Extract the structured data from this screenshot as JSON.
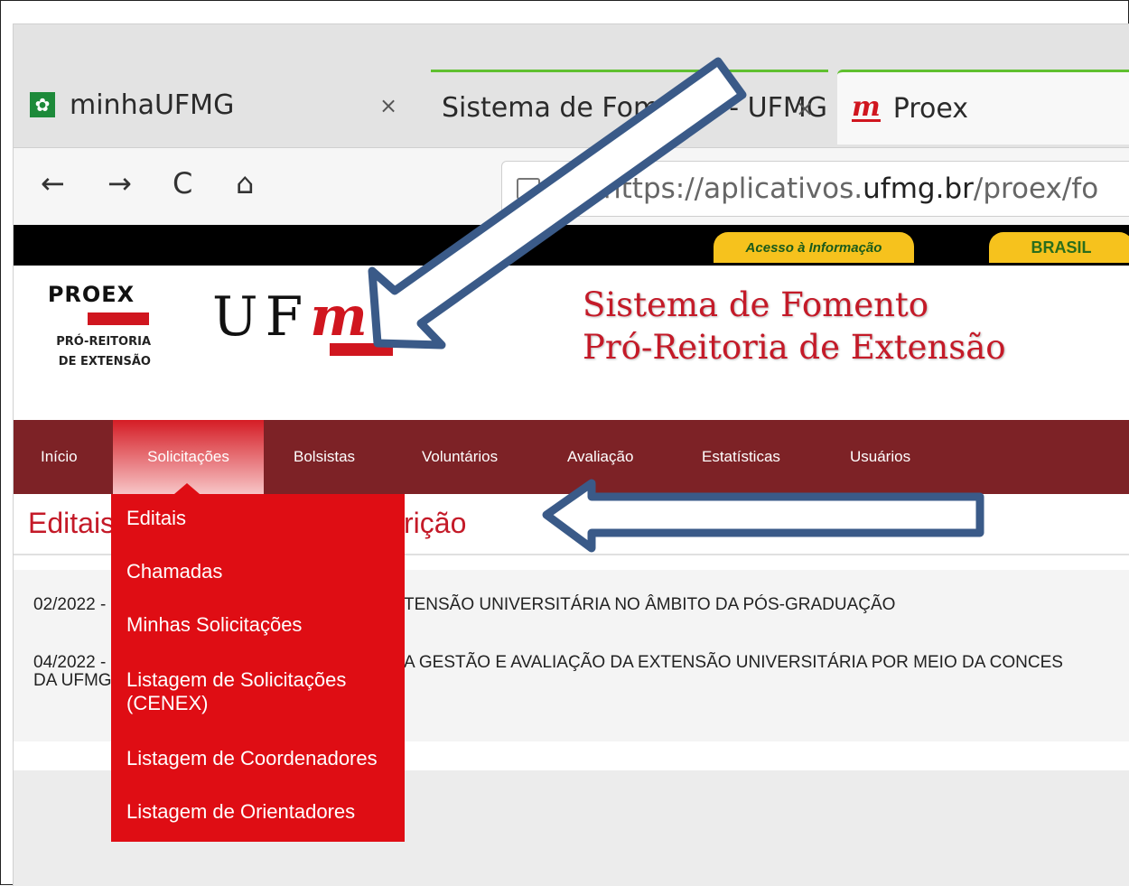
{
  "browser": {
    "tabs": [
      {
        "title": "minhaUFMG",
        "favicon": "ufmg-leaf-icon",
        "close": "×"
      },
      {
        "title": "Sistema de Fomento - UFMG",
        "close": "×"
      },
      {
        "title": "Proex",
        "favicon": "m-logo-icon"
      }
    ],
    "nav": {
      "back": "←",
      "forward": "→",
      "reload": "C",
      "home": "⌂"
    },
    "url": {
      "scheme": "https://aplicativos.",
      "domain": "ufmg.br",
      "path": "/proex/fo"
    }
  },
  "govbar": {
    "access": "Acesso à Informação",
    "brasil": "BRASIL"
  },
  "header": {
    "proex": "PROEX",
    "proex_sub1": "PRÓ-REITORIA",
    "proex_sub2": "DE EXTENSÃO",
    "ufmg_left": "UF",
    "ufmg_m": "m",
    "ufmg_right": "G",
    "system_line1": "Sistema de Fomento",
    "system_line2": "Pró-Reitoria de Extensão"
  },
  "nav": {
    "items": [
      "Início",
      "Solicitações",
      "Bolsistas",
      "Voluntários",
      "Avaliação",
      "Estatísticas",
      "Usuários"
    ]
  },
  "content": {
    "title_left": "Editais",
    "title_right": "rição",
    "rows": [
      {
        "left": "02/2022 -",
        "right": "TENSÃO UNIVERSITÁRIA NO ÂMBITO DA PÓS-GRADUAÇÃO"
      },
      {
        "left": "04/2022 -",
        "left2": "DA UFMG",
        "right": "A GESTÃO E AVALIAÇÃO DA EXTENSÃO UNIVERSITÁRIA POR MEIO DA CONCES"
      }
    ]
  },
  "dropdown": {
    "items": [
      "Editais",
      "Chamadas",
      "Minhas Solicitações",
      "Listagem de Solicitações (CENEX)",
      "Listagem de Coordenadores",
      "Listagem de Orientadores"
    ]
  },
  "colors": {
    "accent": "#d0161f",
    "nav_bg": "#7d2226",
    "arrow": "#3a5a88"
  }
}
